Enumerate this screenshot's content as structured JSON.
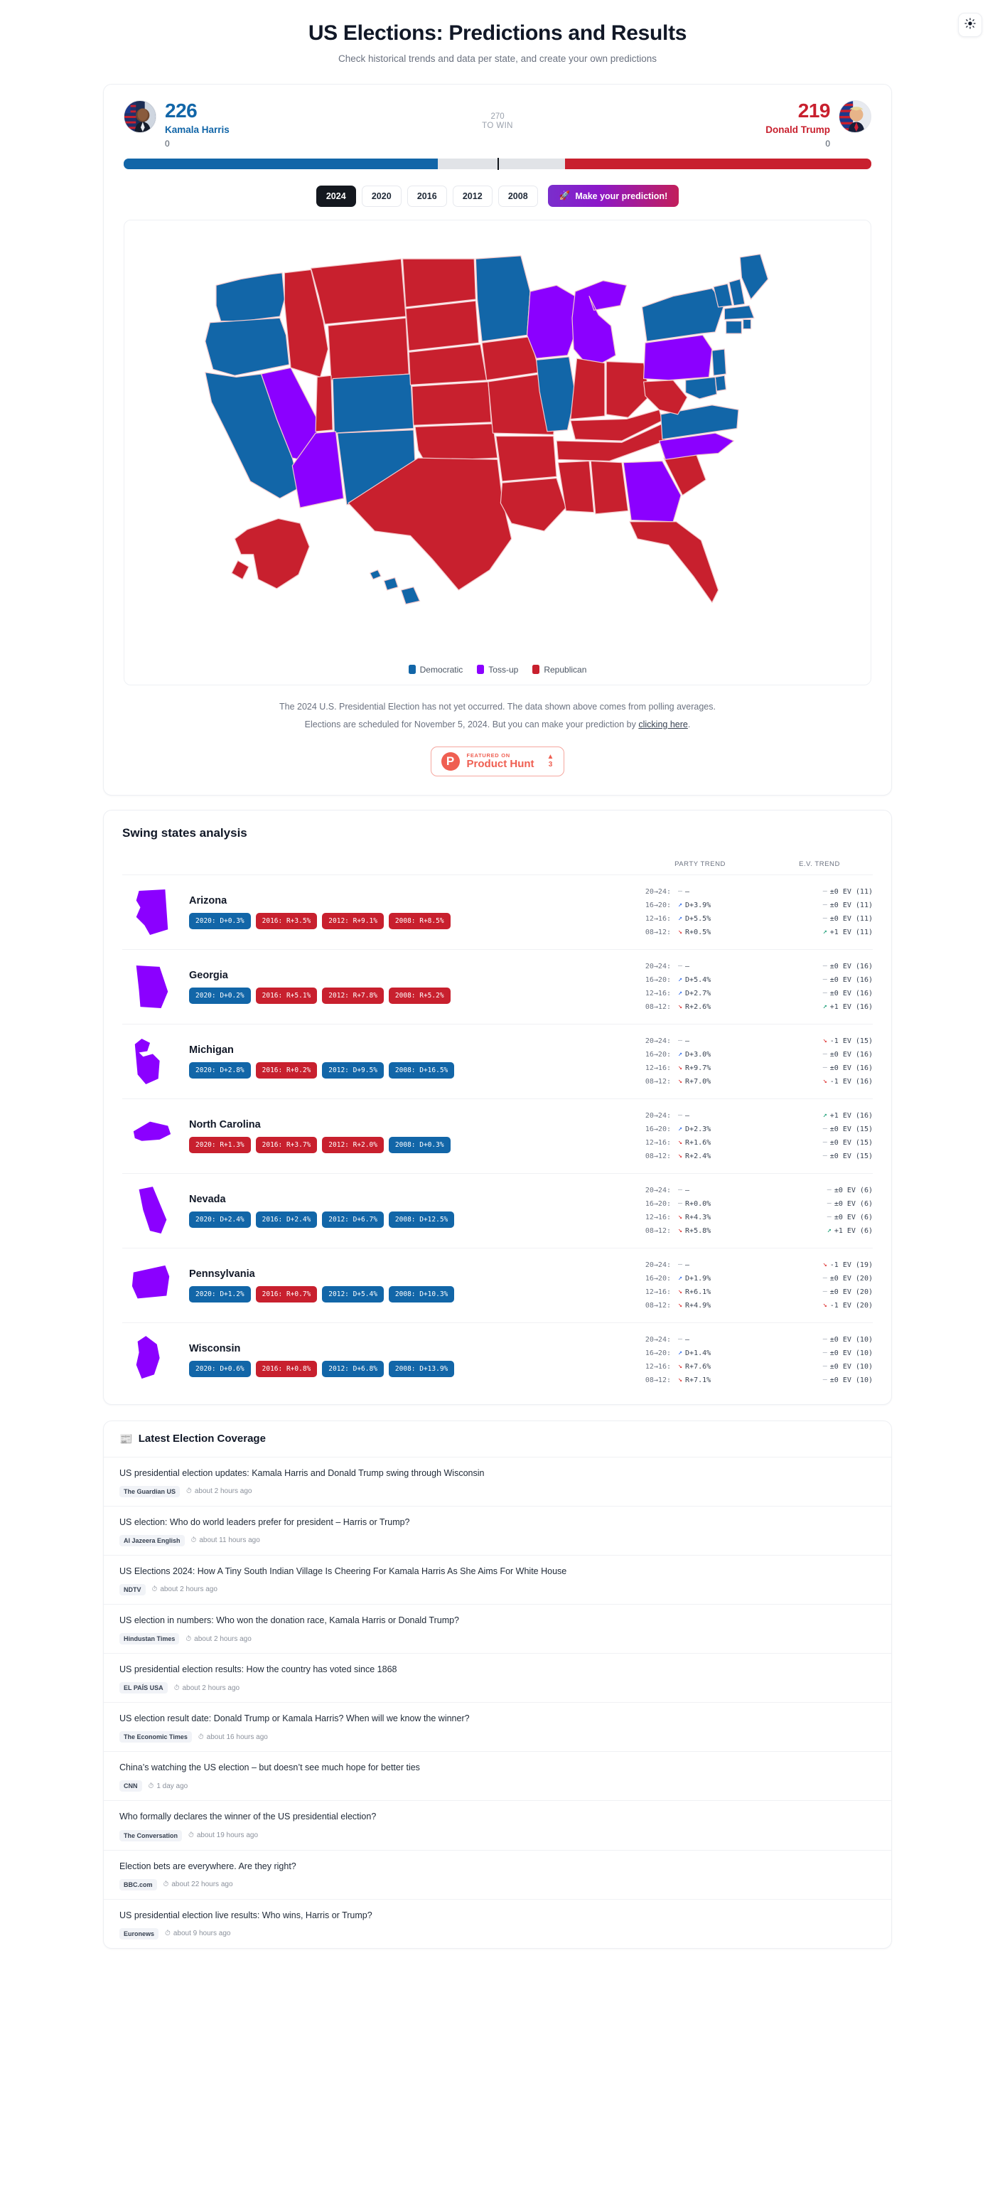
{
  "header": {
    "title": "US Elections: Predictions and Results",
    "subtitle": "Check historical trends and data per state, and create your own predictions",
    "theme_toggle_icon": "sun-icon"
  },
  "scoreboard": {
    "left": {
      "name": "Kamala Harris",
      "ev": "226",
      "states_won": "0",
      "party": "Democratic",
      "color": "#1266a8",
      "bar_pct": 42
    },
    "right": {
      "name": "Donald Trump",
      "ev": "219",
      "states_won": "0",
      "party": "Republican",
      "color": "#c8202e",
      "bar_pct": 41
    },
    "threshold_number": "270",
    "threshold_label": "TO WIN"
  },
  "year_tabs": [
    {
      "label": "2024",
      "active": true
    },
    {
      "label": "2020",
      "active": false
    },
    {
      "label": "2016",
      "active": false
    },
    {
      "label": "2012",
      "active": false
    },
    {
      "label": "2008",
      "active": false
    }
  ],
  "predict_button": {
    "label": "Make your prediction!",
    "icon": "rocket-icon"
  },
  "legend": [
    {
      "label": "Democratic",
      "color": "#1266a8"
    },
    {
      "label": "Toss-up",
      "color": "#8b00ff"
    },
    {
      "label": "Republican",
      "color": "#c8202e"
    }
  ],
  "disclaimer": {
    "line1": "The 2024 U.S. Presidential Election has not yet occurred. The data shown above comes from polling averages.",
    "line2_prefix": "Elections are scheduled for November 5, 2024. But you can make your prediction by ",
    "line2_link": "clicking here",
    "line2_suffix": "."
  },
  "product_hunt": {
    "featured_on": "FEATURED ON",
    "name": "Product Hunt",
    "logo_letter": "P",
    "votes": "3"
  },
  "swing": {
    "title": "Swing states analysis",
    "col_party": "PARTY TREND",
    "col_ev": "E.V. TREND",
    "states": [
      {
        "name": "Arizona",
        "results": [
          {
            "label": "2020: D+0.3%",
            "party": "d"
          },
          {
            "label": "2016: R+3.5%",
            "party": "r"
          },
          {
            "label": "2012: R+9.1%",
            "party": "r"
          },
          {
            "label": "2008: R+8.5%",
            "party": "r"
          }
        ],
        "trends": [
          {
            "period": "20→24:",
            "party_arrow": "flat",
            "party": "–",
            "ev_arrow": "flat",
            "ev": "±0 EV (11)"
          },
          {
            "period": "16→20:",
            "party_arrow": "up",
            "party": "D+3.9%",
            "ev_arrow": "flat",
            "ev": "±0 EV (11)"
          },
          {
            "period": "12→16:",
            "party_arrow": "up",
            "party": "D+5.5%",
            "ev_arrow": "flat",
            "ev": "±0 EV (11)"
          },
          {
            "period": "08→12:",
            "party_arrow": "down",
            "party": "R+0.5%",
            "ev_arrow": "gup",
            "ev": "+1 EV (11)"
          }
        ]
      },
      {
        "name": "Georgia",
        "results": [
          {
            "label": "2020: D+0.2%",
            "party": "d"
          },
          {
            "label": "2016: R+5.1%",
            "party": "r"
          },
          {
            "label": "2012: R+7.8%",
            "party": "r"
          },
          {
            "label": "2008: R+5.2%",
            "party": "r"
          }
        ],
        "trends": [
          {
            "period": "20→24:",
            "party_arrow": "flat",
            "party": "–",
            "ev_arrow": "flat",
            "ev": "±0 EV (16)"
          },
          {
            "period": "16→20:",
            "party_arrow": "up",
            "party": "D+5.4%",
            "ev_arrow": "flat",
            "ev": "±0 EV (16)"
          },
          {
            "period": "12→16:",
            "party_arrow": "up",
            "party": "D+2.7%",
            "ev_arrow": "flat",
            "ev": "±0 EV (16)"
          },
          {
            "period": "08→12:",
            "party_arrow": "down",
            "party": "R+2.6%",
            "ev_arrow": "gup",
            "ev": "+1 EV (16)"
          }
        ]
      },
      {
        "name": "Michigan",
        "results": [
          {
            "label": "2020: D+2.8%",
            "party": "d"
          },
          {
            "label": "2016: R+0.2%",
            "party": "r"
          },
          {
            "label": "2012: D+9.5%",
            "party": "d"
          },
          {
            "label": "2008: D+16.5%",
            "party": "d"
          }
        ],
        "trends": [
          {
            "period": "20→24:",
            "party_arrow": "flat",
            "party": "–",
            "ev_arrow": "down",
            "ev": "-1 EV (15)"
          },
          {
            "period": "16→20:",
            "party_arrow": "up",
            "party": "D+3.0%",
            "ev_arrow": "flat",
            "ev": "±0 EV (16)"
          },
          {
            "period": "12→16:",
            "party_arrow": "down",
            "party": "R+9.7%",
            "ev_arrow": "flat",
            "ev": "±0 EV (16)"
          },
          {
            "period": "08→12:",
            "party_arrow": "down",
            "party": "R+7.0%",
            "ev_arrow": "down",
            "ev": "-1 EV (16)"
          }
        ]
      },
      {
        "name": "North Carolina",
        "results": [
          {
            "label": "2020: R+1.3%",
            "party": "r"
          },
          {
            "label": "2016: R+3.7%",
            "party": "r"
          },
          {
            "label": "2012: R+2.0%",
            "party": "r"
          },
          {
            "label": "2008: D+0.3%",
            "party": "d"
          }
        ],
        "trends": [
          {
            "period": "20→24:",
            "party_arrow": "flat",
            "party": "–",
            "ev_arrow": "gup",
            "ev": "+1 EV (16)"
          },
          {
            "period": "16→20:",
            "party_arrow": "up",
            "party": "D+2.3%",
            "ev_arrow": "flat",
            "ev": "±0 EV (15)"
          },
          {
            "period": "12→16:",
            "party_arrow": "down",
            "party": "R+1.6%",
            "ev_arrow": "flat",
            "ev": "±0 EV (15)"
          },
          {
            "period": "08→12:",
            "party_arrow": "down",
            "party": "R+2.4%",
            "ev_arrow": "flat",
            "ev": "±0 EV (15)"
          }
        ]
      },
      {
        "name": "Nevada",
        "results": [
          {
            "label": "2020: D+2.4%",
            "party": "d"
          },
          {
            "label": "2016: D+2.4%",
            "party": "d"
          },
          {
            "label": "2012: D+6.7%",
            "party": "d"
          },
          {
            "label": "2008: D+12.5%",
            "party": "d"
          }
        ],
        "trends": [
          {
            "period": "20→24:",
            "party_arrow": "flat",
            "party": "–",
            "ev_arrow": "flat",
            "ev": "±0 EV (6)"
          },
          {
            "period": "16→20:",
            "party_arrow": "flat",
            "party": "R+0.0%",
            "ev_arrow": "flat",
            "ev": "±0 EV (6)"
          },
          {
            "period": "12→16:",
            "party_arrow": "down",
            "party": "R+4.3%",
            "ev_arrow": "flat",
            "ev": "±0 EV (6)"
          },
          {
            "period": "08→12:",
            "party_arrow": "down",
            "party": "R+5.8%",
            "ev_arrow": "gup",
            "ev": "+1 EV (6)"
          }
        ]
      },
      {
        "name": "Pennsylvania",
        "results": [
          {
            "label": "2020: D+1.2%",
            "party": "d"
          },
          {
            "label": "2016: R+0.7%",
            "party": "r"
          },
          {
            "label": "2012: D+5.4%",
            "party": "d"
          },
          {
            "label": "2008: D+10.3%",
            "party": "d"
          }
        ],
        "trends": [
          {
            "period": "20→24:",
            "party_arrow": "flat",
            "party": "–",
            "ev_arrow": "down",
            "ev": "-1 EV (19)"
          },
          {
            "period": "16→20:",
            "party_arrow": "up",
            "party": "D+1.9%",
            "ev_arrow": "flat",
            "ev": "±0 EV (20)"
          },
          {
            "period": "12→16:",
            "party_arrow": "down",
            "party": "R+6.1%",
            "ev_arrow": "flat",
            "ev": "±0 EV (20)"
          },
          {
            "period": "08→12:",
            "party_arrow": "down",
            "party": "R+4.9%",
            "ev_arrow": "down",
            "ev": "-1 EV (20)"
          }
        ]
      },
      {
        "name": "Wisconsin",
        "results": [
          {
            "label": "2020: D+0.6%",
            "party": "d"
          },
          {
            "label": "2016: R+0.8%",
            "party": "r"
          },
          {
            "label": "2012: D+6.8%",
            "party": "d"
          },
          {
            "label": "2008: D+13.9%",
            "party": "d"
          }
        ],
        "trends": [
          {
            "period": "20→24:",
            "party_arrow": "flat",
            "party": "–",
            "ev_arrow": "flat",
            "ev": "±0 EV (10)"
          },
          {
            "period": "16→20:",
            "party_arrow": "up",
            "party": "D+1.4%",
            "ev_arrow": "flat",
            "ev": "±0 EV (10)"
          },
          {
            "period": "12→16:",
            "party_arrow": "down",
            "party": "R+7.6%",
            "ev_arrow": "flat",
            "ev": "±0 EV (10)"
          },
          {
            "period": "08→12:",
            "party_arrow": "down",
            "party": "R+7.1%",
            "ev_arrow": "flat",
            "ev": "±0 EV (10)"
          }
        ]
      }
    ]
  },
  "news": {
    "title": "Latest Election Coverage",
    "icon": "newspaper-icon",
    "items": [
      {
        "title": "US presidential election updates: Kamala Harris and Donald Trump swing through Wisconsin",
        "source": "The Guardian US",
        "time": "about 2 hours ago"
      },
      {
        "title": "US election: Who do world leaders prefer for president – Harris or Trump?",
        "source": "Al Jazeera English",
        "time": "about 11 hours ago"
      },
      {
        "title": "US Elections 2024: How A Tiny South Indian Village Is Cheering For Kamala Harris As She Aims For White House",
        "source": "NDTV",
        "time": "about 2 hours ago"
      },
      {
        "title": "US election in numbers: Who won the donation race, Kamala Harris or Donald Trump?",
        "source": "Hindustan Times",
        "time": "about 2 hours ago"
      },
      {
        "title": "US presidential election results: How the country has voted since 1868",
        "source": "EL PAÍS USA",
        "time": "about 2 hours ago"
      },
      {
        "title": "US election result date: Donald Trump or Kamala Harris? When will we know the winner?",
        "source": "The Economic Times",
        "time": "about 16 hours ago"
      },
      {
        "title": "China’s watching the US election – but doesn’t see much hope for better ties",
        "source": "CNN",
        "time": "1 day ago"
      },
      {
        "title": "Who formally declares the winner of the US presidential election?",
        "source": "The Conversation",
        "time": "about 19 hours ago"
      },
      {
        "title": "Election bets are everywhere. Are they right?",
        "source": "BBC.com",
        "time": "about 22 hours ago"
      },
      {
        "title": "US presidential election live results: Who wins, Harris or Trump?",
        "source": "Euronews",
        "time": "about 9 hours ago"
      }
    ]
  },
  "map": {
    "type": "choropleth",
    "title": "2024 US electoral map by state",
    "state_colors": {
      "WA": "dem",
      "OR": "dem",
      "CA": "dem",
      "NV": "toss",
      "ID": "rep",
      "MT": "rep",
      "WY": "rep",
      "UT": "rep",
      "AZ": "toss",
      "CO": "dem",
      "NM": "dem",
      "ND": "rep",
      "SD": "rep",
      "NE": "rep",
      "KS": "rep",
      "OK": "rep",
      "TX": "rep",
      "MN": "dem",
      "IA": "rep",
      "MO": "rep",
      "AR": "rep",
      "LA": "rep",
      "WI": "toss",
      "IL": "dem",
      "MI": "toss",
      "IN": "rep",
      "OH": "rep",
      "KY": "rep",
      "TN": "rep",
      "MS": "rep",
      "AL": "rep",
      "GA": "toss",
      "FL": "rep",
      "SC": "rep",
      "NC": "toss",
      "VA": "dem",
      "WV": "rep",
      "PA": "toss",
      "NY": "dem",
      "VT": "dem",
      "NH": "dem",
      "ME": "dem",
      "MA": "dem",
      "RI": "dem",
      "CT": "dem",
      "NJ": "dem",
      "DE": "dem",
      "MD": "dem",
      "AK": "rep",
      "HI": "dem"
    }
  }
}
